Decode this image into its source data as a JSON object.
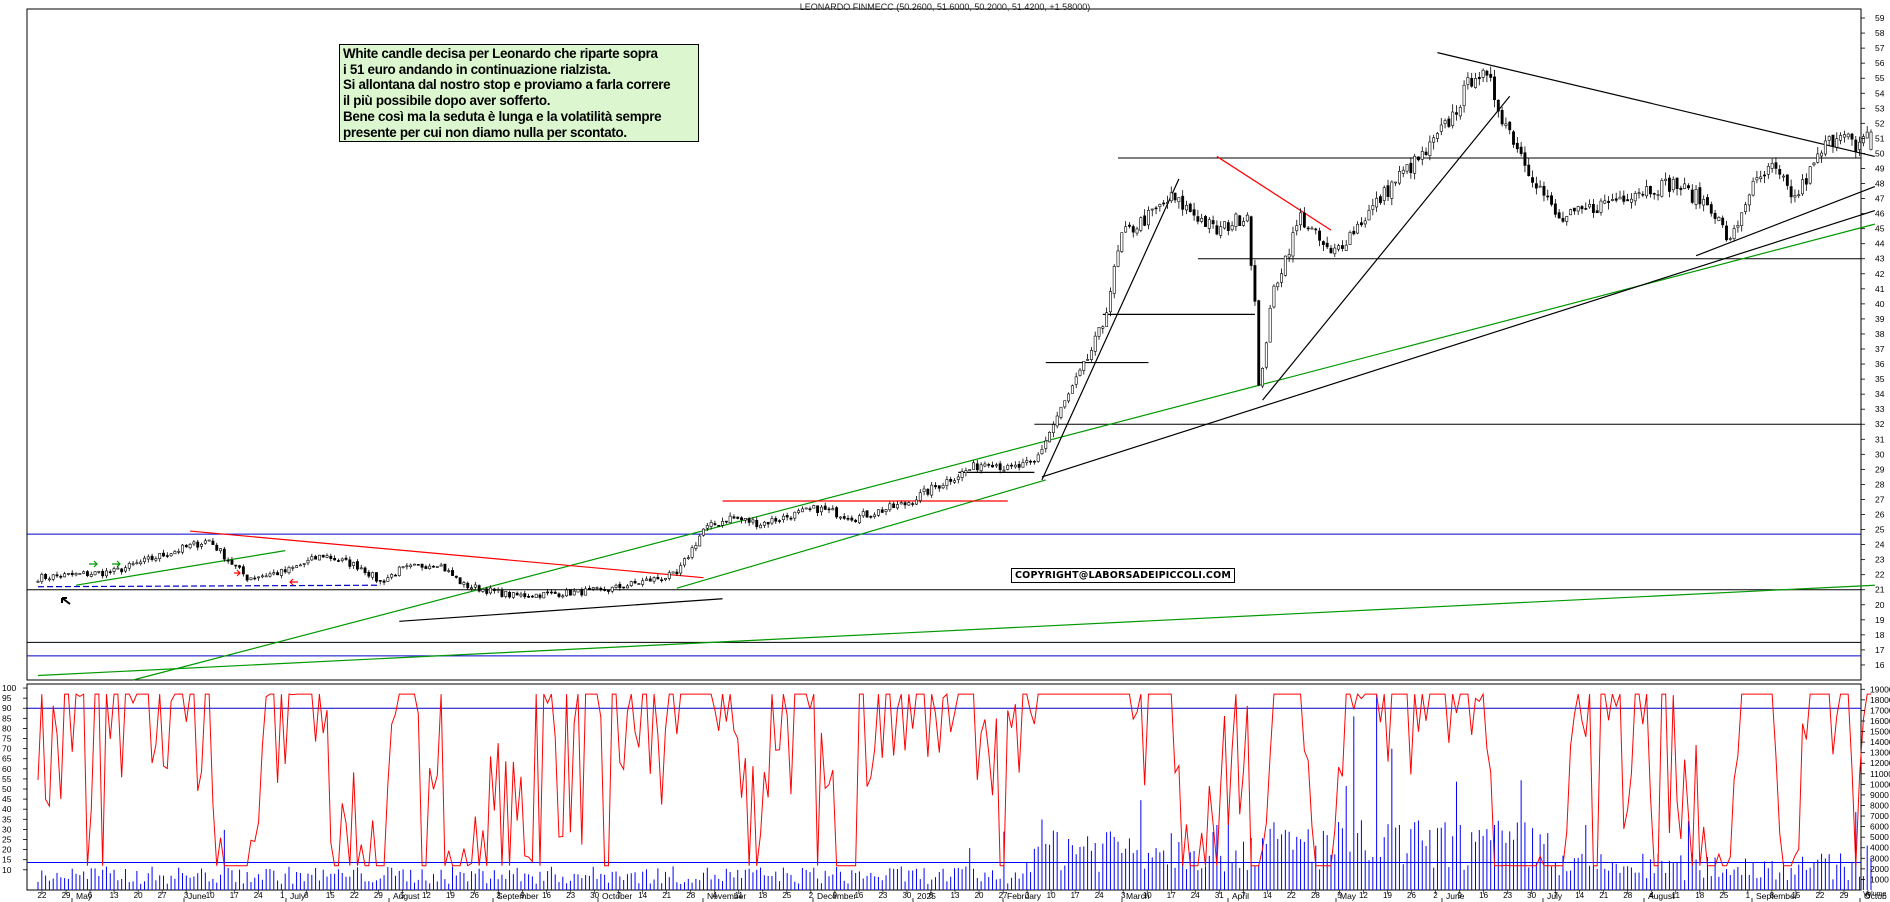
{
  "header": {
    "title": "LEONARDO FINMECC (50.2600, 51.6000, 50.2000, 51.4200, +1.58000)"
  },
  "annotation": {
    "lines": [
      "White candle decisa per Leonardo che riparte sopra",
      "i 51 euro andando in continuazione rialzista.",
      "Si allontana dal nostro stop e proviamo a farla correre",
      "il più possibile dopo aver sofferto.",
      "Bene così ma la seduta è lunga e la volatilità sempre",
      "presente per cui non diamo nulla per scontato."
    ]
  },
  "copyright": "COPYRIGHT@LABORSADEIPICCOLI.COM",
  "colors": {
    "candle": "#000000",
    "support": "#0000cc",
    "trend_red": "#ff0000",
    "trend_green": "#009900",
    "oscillator": "#ff0000",
    "volume": "#0000ff",
    "note_bg": "#dcf7cf"
  },
  "chart_data": [
    {
      "type": "candlestick",
      "name_printed": "LEONARDO FINMECC",
      "last_bar": {
        "open": 50.26,
        "high": 51.6,
        "low": 50.2,
        "close": 51.42,
        "change": 1.58
      },
      "y_ticks": [
        16,
        17,
        18,
        19,
        20,
        21,
        22,
        23,
        24,
        25,
        26,
        27,
        28,
        29,
        30,
        31,
        32,
        33,
        34,
        35,
        36,
        37,
        38,
        39,
        40,
        41,
        42,
        43,
        44,
        45,
        46,
        47,
        48,
        49,
        50,
        51,
        52,
        53,
        54,
        55,
        56,
        57,
        58,
        59
      ],
      "ylim": [
        15,
        59.6
      ],
      "horizontal_levels": [
        {
          "value": 24.7,
          "color": "blue"
        },
        {
          "value": 21.0,
          "color": "black"
        },
        {
          "value": 17.5,
          "color": "black"
        },
        {
          "value": 16.6,
          "color": "blue"
        },
        {
          "value": 15.0,
          "color": "black"
        },
        {
          "value": 32.0,
          "color": "black"
        },
        {
          "value": 43.0,
          "color": "black"
        },
        {
          "value": 49.7,
          "color": "black"
        }
      ],
      "close_anchors": [
        [
          0,
          21.8
        ],
        [
          20,
          22.2
        ],
        [
          35,
          23.5
        ],
        [
          45,
          24.3
        ],
        [
          50,
          23.0
        ],
        [
          55,
          21.8
        ],
        [
          65,
          22.2
        ],
        [
          75,
          23.3
        ],
        [
          85,
          22.5
        ],
        [
          90,
          21.5
        ],
        [
          95,
          22.3
        ],
        [
          105,
          22.8
        ],
        [
          112,
          21.3
        ],
        [
          125,
          20.6
        ],
        [
          140,
          20.8
        ],
        [
          150,
          21.0
        ],
        [
          160,
          21.6
        ],
        [
          168,
          22.0
        ],
        [
          175,
          25.0
        ],
        [
          182,
          25.8
        ],
        [
          190,
          25.4
        ],
        [
          205,
          26.4
        ],
        [
          215,
          25.8
        ],
        [
          228,
          26.7
        ],
        [
          240,
          28.4
        ],
        [
          250,
          29.6
        ],
        [
          255,
          29.0
        ],
        [
          262,
          29.4
        ],
        [
          268,
          32.5
        ],
        [
          275,
          35.8
        ],
        [
          280,
          38.6
        ],
        [
          285,
          44.5
        ],
        [
          292,
          45.8
        ],
        [
          298,
          47.0
        ],
        [
          303,
          46.2
        ],
        [
          310,
          44.8
        ],
        [
          318,
          46.0
        ],
        [
          320,
          40.0
        ],
        [
          321,
          34.3
        ],
        [
          325,
          41.0
        ],
        [
          332,
          45.8
        ],
        [
          340,
          43.2
        ],
        [
          348,
          45.5
        ],
        [
          358,
          48.5
        ],
        [
          365,
          50.0
        ],
        [
          372,
          52.5
        ],
        [
          378,
          55.5
        ],
        [
          382,
          54.5
        ],
        [
          385,
          52.5
        ],
        [
          392,
          49.0
        ],
        [
          400,
          45.5
        ],
        [
          410,
          46.5
        ],
        [
          420,
          47.5
        ],
        [
          430,
          48.0
        ],
        [
          440,
          46.5
        ],
        [
          445,
          44.0
        ],
        [
          450,
          47.5
        ],
        [
          456,
          49.0
        ],
        [
          462,
          47.0
        ],
        [
          470,
          50.5
        ],
        [
          475,
          51.8
        ],
        [
          478,
          50.0
        ],
        [
          482,
          51.42
        ]
      ],
      "x_day_labels": [
        "22",
        "29",
        "6",
        "13",
        "20",
        "27",
        "3",
        "10",
        "17",
        "24",
        "1",
        "8",
        "15",
        "22",
        "29",
        "5",
        "12",
        "19",
        "26",
        "2",
        "9",
        "16",
        "23",
        "30",
        "7",
        "14",
        "21",
        "28",
        "4",
        "11",
        "18",
        "25",
        "2",
        "9",
        "16",
        "23",
        "30",
        "6",
        "13",
        "20",
        "27",
        "3",
        "10",
        "17",
        "24",
        "3",
        "10",
        "17",
        "24",
        "31",
        "7",
        "14",
        "22",
        "28",
        "5",
        "12",
        "19",
        "26",
        "2",
        "9",
        "16",
        "23",
        "30",
        "7",
        "14",
        "21",
        "28",
        "4",
        "11",
        "18",
        "25",
        "1",
        "8",
        "15",
        "22",
        "29",
        "6"
      ],
      "x_month_labels": [
        "May",
        "June",
        "July",
        "August",
        "September",
        "October",
        "November",
        "December",
        "2025",
        "February",
        "March",
        "April",
        "May",
        "June",
        "July",
        "August",
        "September",
        "Octob"
      ]
    },
    {
      "type": "line",
      "name_printed": "",
      "y_ticks": [
        10,
        15,
        20,
        25,
        30,
        35,
        40,
        45,
        50,
        55,
        60,
        65,
        70,
        75,
        80,
        85,
        90,
        95,
        100
      ],
      "ylim": [
        0,
        102
      ],
      "reference_level": 90,
      "period_days": 5
    },
    {
      "type": "bar",
      "name_printed": "",
      "y_ticks": [
        1000,
        2000,
        3000,
        4000,
        5000,
        6000,
        7000,
        8000,
        9000,
        10000,
        11000,
        12000,
        13000,
        14000,
        15000,
        16000,
        17000,
        18000,
        19000
      ],
      "ylim": [
        0,
        19500
      ],
      "reference_level": 2600,
      "axis_tag": "Volume"
    }
  ]
}
